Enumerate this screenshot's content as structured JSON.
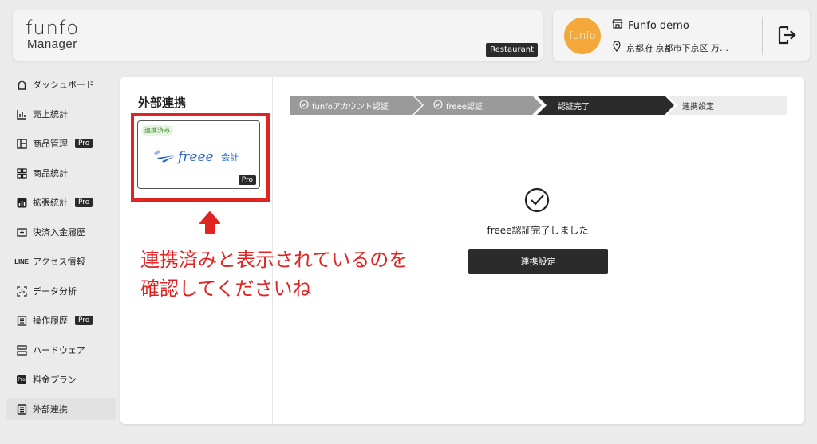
{
  "header": {
    "logo_top": "funfo",
    "logo_sub": "Manager",
    "restaurant_badge": "Restaurant",
    "avatar_text": "funfo",
    "store_name": "Funfo demo",
    "address": "京都府 京都市下京区 万…"
  },
  "sidebar": {
    "items": [
      {
        "label": "ダッシュボード",
        "icon": "home-icon"
      },
      {
        "label": "売上統計",
        "icon": "bar-chart-icon"
      },
      {
        "label": "商品管理",
        "icon": "product-manage-icon",
        "pro": "Pro"
      },
      {
        "label": "商品統計",
        "icon": "grid-icon"
      },
      {
        "label": "拡張統計",
        "icon": "extended-stats-icon",
        "pro": "Pro"
      },
      {
        "label": "決済入金履歴",
        "icon": "payment-icon"
      },
      {
        "label": "アクセス情報",
        "icon": "line-icon",
        "icon_text": "LINE"
      },
      {
        "label": "データ分析",
        "icon": "data-analysis-icon"
      },
      {
        "label": "操作履歴",
        "icon": "history-icon",
        "pro": "Pro"
      },
      {
        "label": "ハードウェア",
        "icon": "hardware-icon"
      },
      {
        "label": "料金プラン",
        "icon": "pro-plan-icon",
        "icon_text": "Pro"
      },
      {
        "label": "外部連携",
        "icon": "external-link-icon"
      }
    ]
  },
  "left_panel": {
    "title": "外部連携",
    "card": {
      "status_tag": "連携済み",
      "logo_text": "freee",
      "logo_suffix": "会計",
      "pro": "Pro"
    },
    "annotation_line1": "連携済みと表示されているのを",
    "annotation_line2": "確認してくださいね"
  },
  "steps": [
    {
      "label": "funfoアカウント認証",
      "state": "done"
    },
    {
      "label": "freee認証",
      "state": "done"
    },
    {
      "label": "認証完了",
      "state": "current"
    },
    {
      "label": "連携設定",
      "state": "pending"
    }
  ],
  "result": {
    "message": "freee認証完了しました",
    "button": "連携設定"
  },
  "colors": {
    "annotation_red": "#e02424",
    "dark": "#2b2b2b",
    "step_done": "#9a9a9a",
    "avatar": "#f2a93a"
  }
}
